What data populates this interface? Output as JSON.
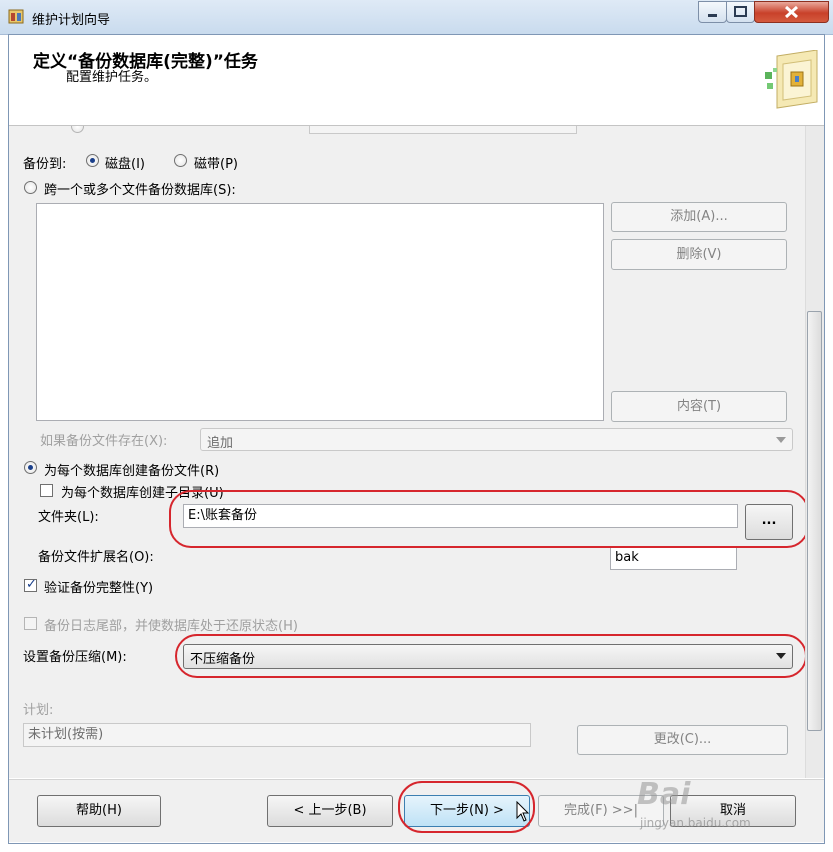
{
  "window": {
    "title": "维护计划向导"
  },
  "header": {
    "title": "定义“备份数据库(完整)”任务",
    "subtitle": "配置维护任务。"
  },
  "top_partial_field": {
    "label": "",
    "value": ""
  },
  "backup_to": {
    "label": "备份到:",
    "disk": "磁盘(I)",
    "tape": "磁带(P)",
    "selected": "disk"
  },
  "span_files": {
    "label": "跨一个或多个文件备份数据库(S):",
    "add": "添加(A)...",
    "remove": "删除(V)",
    "contents": "内容(T)"
  },
  "if_exists": {
    "label": "如果备份文件存在(X):",
    "value": "追加"
  },
  "per_db": {
    "label": "为每个数据库创建备份文件(R)",
    "subdir_label": "为每个数据库创建子目录(U)",
    "subdir_checked": false
  },
  "folder": {
    "label": "文件夹(L):",
    "value": "E:\\账套备份",
    "browse": "..."
  },
  "extension": {
    "label": "备份文件扩展名(O):",
    "value": "bak"
  },
  "verify": {
    "label": "验证备份完整性(Y)",
    "checked": true
  },
  "tail_log": {
    "label": "备份日志尾部，并使数据库处于还原状态(H)",
    "checked": false
  },
  "compression": {
    "label": "设置备份压缩(M):",
    "value": "不压缩备份"
  },
  "schedule": {
    "label": "计划:",
    "value": "未计划(按需)",
    "change": "更改(C)..."
  },
  "footer": {
    "help": "帮助(H)",
    "back": "< 上一步(B)",
    "next": "下一步(N) >",
    "finish": "完成(F) >>|",
    "cancel": "取消"
  },
  "watermark": {
    "text": "Bai",
    "url": "jingyan.baidu.com"
  },
  "colors": {
    "highlight": "#d6262d",
    "titlebar": "#c9dbee",
    "panel": "#f0f0f0"
  }
}
